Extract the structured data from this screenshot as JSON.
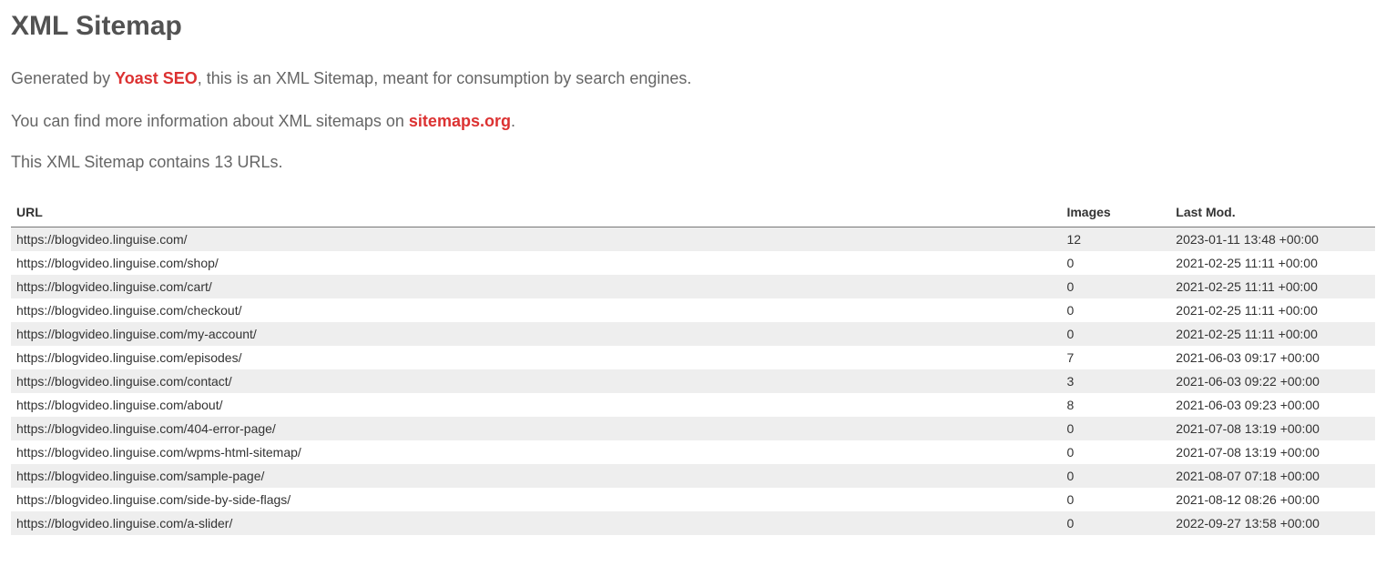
{
  "title": "XML Sitemap",
  "intro": {
    "generated_by_prefix": "Generated by ",
    "generated_by_link": "Yoast SEO",
    "generated_by_suffix": ", this is an XML Sitemap, meant for consumption by search engines.",
    "more_info_prefix": "You can find more information about XML sitemaps on ",
    "more_info_link": "sitemaps.org",
    "more_info_suffix": "."
  },
  "count_text": "This XML Sitemap contains 13 URLs.",
  "table": {
    "headers": {
      "url": "URL",
      "images": "Images",
      "lastmod": "Last Mod."
    },
    "rows": [
      {
        "url": "https://blogvideo.linguise.com/",
        "images": "12",
        "lastmod": "2023-01-11 13:48 +00:00"
      },
      {
        "url": "https://blogvideo.linguise.com/shop/",
        "images": "0",
        "lastmod": "2021-02-25 11:11 +00:00"
      },
      {
        "url": "https://blogvideo.linguise.com/cart/",
        "images": "0",
        "lastmod": "2021-02-25 11:11 +00:00"
      },
      {
        "url": "https://blogvideo.linguise.com/checkout/",
        "images": "0",
        "lastmod": "2021-02-25 11:11 +00:00"
      },
      {
        "url": "https://blogvideo.linguise.com/my-account/",
        "images": "0",
        "lastmod": "2021-02-25 11:11 +00:00"
      },
      {
        "url": "https://blogvideo.linguise.com/episodes/",
        "images": "7",
        "lastmod": "2021-06-03 09:17 +00:00"
      },
      {
        "url": "https://blogvideo.linguise.com/contact/",
        "images": "3",
        "lastmod": "2021-06-03 09:22 +00:00"
      },
      {
        "url": "https://blogvideo.linguise.com/about/",
        "images": "8",
        "lastmod": "2021-06-03 09:23 +00:00"
      },
      {
        "url": "https://blogvideo.linguise.com/404-error-page/",
        "images": "0",
        "lastmod": "2021-07-08 13:19 +00:00"
      },
      {
        "url": "https://blogvideo.linguise.com/wpms-html-sitemap/",
        "images": "0",
        "lastmod": "2021-07-08 13:19 +00:00"
      },
      {
        "url": "https://blogvideo.linguise.com/sample-page/",
        "images": "0",
        "lastmod": "2021-08-07 07:18 +00:00"
      },
      {
        "url": "https://blogvideo.linguise.com/side-by-side-flags/",
        "images": "0",
        "lastmod": "2021-08-12 08:26 +00:00"
      },
      {
        "url": "https://blogvideo.linguise.com/a-slider/",
        "images": "0",
        "lastmod": "2022-09-27 13:58 +00:00"
      }
    ]
  }
}
